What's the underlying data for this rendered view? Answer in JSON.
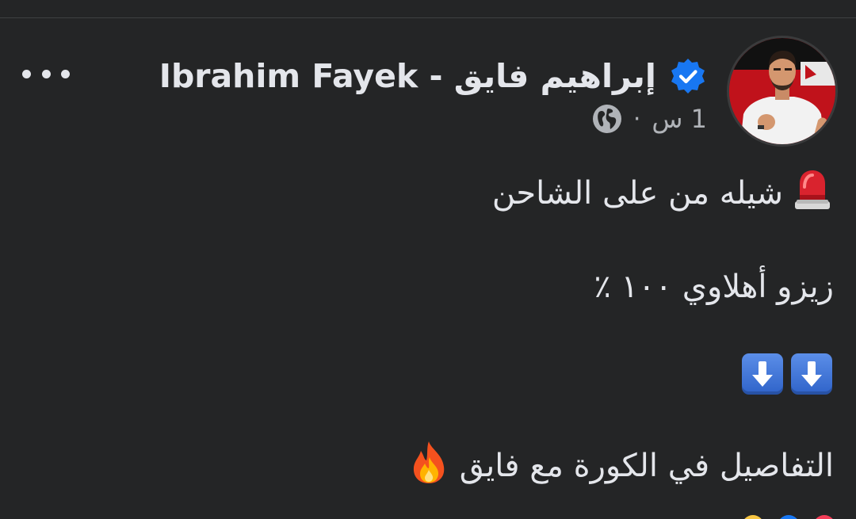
{
  "post": {
    "author": "Ibrahim Fayek - إبراهيم فايق",
    "verified": true,
    "timestamp": "1 س",
    "separator": "·",
    "audience_icon": "globe-icon",
    "more_icon": "more-options-icon",
    "lines": [
      {
        "emoji": "police-light-emoji",
        "text": "شيله من على الشاحن"
      },
      {
        "text": "زيزو أهلاوي ١٠٠ ٪"
      },
      {
        "emoji": "down-arrow-emoji"
      },
      {
        "text": "التفاصيل في الكورة مع فايق",
        "emoji": "fire-emoji"
      }
    ]
  },
  "colors": {
    "background": "#242526",
    "text": "#e4e6eb",
    "secondary_text": "#b0b3b8",
    "verified_blue": "#1877f2",
    "avatar_bg": "#c0121b"
  }
}
